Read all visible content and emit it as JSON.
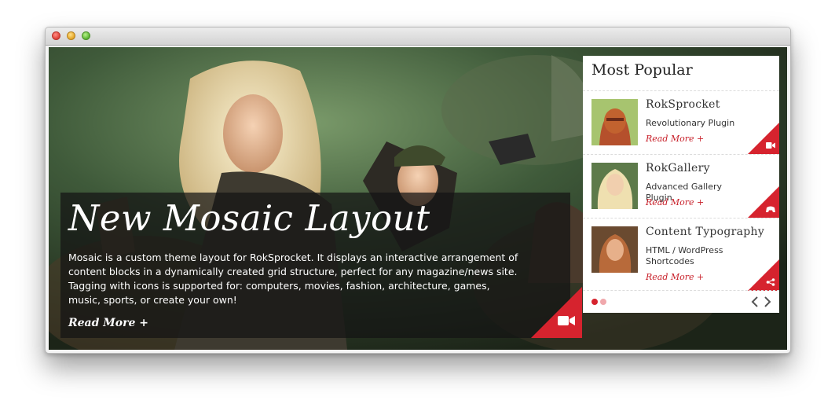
{
  "hero": {
    "title": "New Mosaic Layout",
    "description": "Mosaic is a custom theme layout for RokSprocket. It displays an interactive arrangement of content blocks in a dynamically created grid structure, perfect for any magazine/news site. Tagging with icons is supported for: computers, movies, fashion, architecture, games, music, sports, or create your own!",
    "read_more": "Read More +",
    "tag_icon": "video-camera-icon"
  },
  "most_popular": {
    "title": "Most Popular",
    "items": [
      {
        "title": "RokSprocket",
        "subtitle": "Revolutionary Plugin",
        "read_more": "Read More +",
        "icon": "video-camera-icon"
      },
      {
        "title": "RokGallery",
        "subtitle": "Advanced Gallery Plugin",
        "read_more": "Read More +",
        "icon": "gamepad-icon"
      },
      {
        "title": "Content Typography",
        "subtitle": "HTML / WordPress Shortcodes",
        "read_more": "Read More +",
        "icon": "share-icon"
      }
    ],
    "pagination": {
      "pages": 2,
      "current": 1
    }
  },
  "colors": {
    "accent": "#d6232e",
    "panel": "#ffffff",
    "caption_bg": "rgba(20,20,20,0.72)"
  }
}
